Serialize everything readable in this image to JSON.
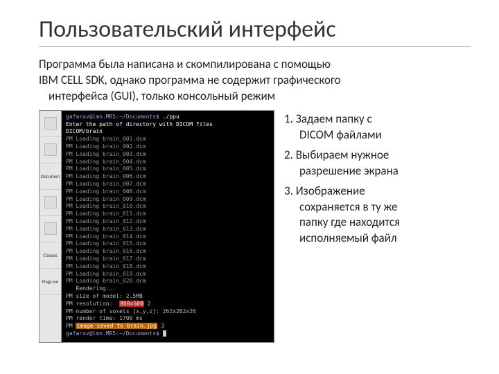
{
  "title": "Пользовательский интерфейс",
  "subtitle": {
    "line1": "Программа была написана и скомпилирована с помощью",
    "line2": "IBM CELL SDK, однако программа не содержит графического",
    "line3": "интерфейса (GUI), только консольный режим"
  },
  "sidebar": {
    "items": [
      "",
      "",
      "Documen",
      "",
      "",
      "Classes",
      "Flags-en"
    ]
  },
  "terminal_lines": [
    {
      "cls": "prompt",
      "prefix": "gafarov@lmn.MR5:~/Documents$ ",
      "text": "./ppu"
    },
    {
      "cls": "input-echo",
      "text": "Enter the path of directory with DICOM files"
    },
    {
      "cls": "input-echo",
      "text": "DICOM/brain"
    },
    {
      "cls": "pm",
      "text": "PM Loading brain_001.dcm"
    },
    {
      "cls": "pm",
      "text": "PM Loading brain_002.dcm"
    },
    {
      "cls": "pm",
      "text": "PM Loading brain_003.dcm"
    },
    {
      "cls": "pm",
      "text": "PM Loading brain_004.dcm"
    },
    {
      "cls": "pm",
      "text": "PM Loading brain_005.dcm"
    },
    {
      "cls": "pm",
      "text": "PM Loading brain_006.dcm"
    },
    {
      "cls": "pm",
      "text": "PM Loading brain_007.dcm"
    },
    {
      "cls": "pm",
      "text": "PM Loading brain_008.dcm"
    },
    {
      "cls": "pm",
      "text": "PM Loading brain_009.dcm"
    },
    {
      "cls": "pm",
      "text": "PM Loading brain_010.dcm"
    },
    {
      "cls": "pm",
      "text": "PM Loading brain_011.dcm"
    },
    {
      "cls": "pm",
      "text": "PM Loading brain_012.dcm"
    },
    {
      "cls": "pm",
      "text": "PM Loading brain_013.dcm"
    },
    {
      "cls": "pm",
      "text": "PM Loading brain_014.dcm"
    },
    {
      "cls": "pm",
      "text": "PM Loading brain_015.dcm"
    },
    {
      "cls": "pm",
      "text": "PM Loading brain_016.dcm"
    },
    {
      "cls": "pm",
      "text": "PM Loading brain_017.dcm"
    },
    {
      "cls": "pm",
      "text": "PM Loading brain_018.dcm"
    },
    {
      "cls": "pm",
      "text": "PM Loading brain_019.dcm"
    },
    {
      "cls": "pm",
      "text": "PM Loading brain_020.dcm"
    },
    {
      "cls": "render",
      "text": "   Rendering..."
    },
    {
      "cls": "render",
      "text": "PM size of model: 2.5MB"
    },
    {
      "cls": "render",
      "text": "PM resolution:  ",
      "hl": "800x600",
      "hl_cls": "hl-red",
      "tail": " 2"
    },
    {
      "cls": "render",
      "text": "PM number of voxels [x,y,z]: 262x262x26"
    },
    {
      "cls": "render",
      "text": "PM render time: 1700 ms"
    },
    {
      "cls": "render",
      "text": "PM ",
      "hl": "image saved to brain.jpg",
      "hl_cls": "hl-orange",
      "tail": " 3"
    },
    {
      "cls": "prompt",
      "prefix": "gafarov@lmn.MR5:~/Documents$ ",
      "text": ""
    }
  ],
  "steps": [
    {
      "num": "1.",
      "l1": "Задаем папку с",
      "l2": "DICOM файлами"
    },
    {
      "num": "2.",
      "l1": "Выбираем нужное",
      "l2": "разрешение экрана"
    },
    {
      "num": "3.",
      "l1": "Изображение",
      "l2": "сохраняется в ту же",
      "l3": "папку где находится",
      "l4": "исполняемый файл"
    }
  ]
}
